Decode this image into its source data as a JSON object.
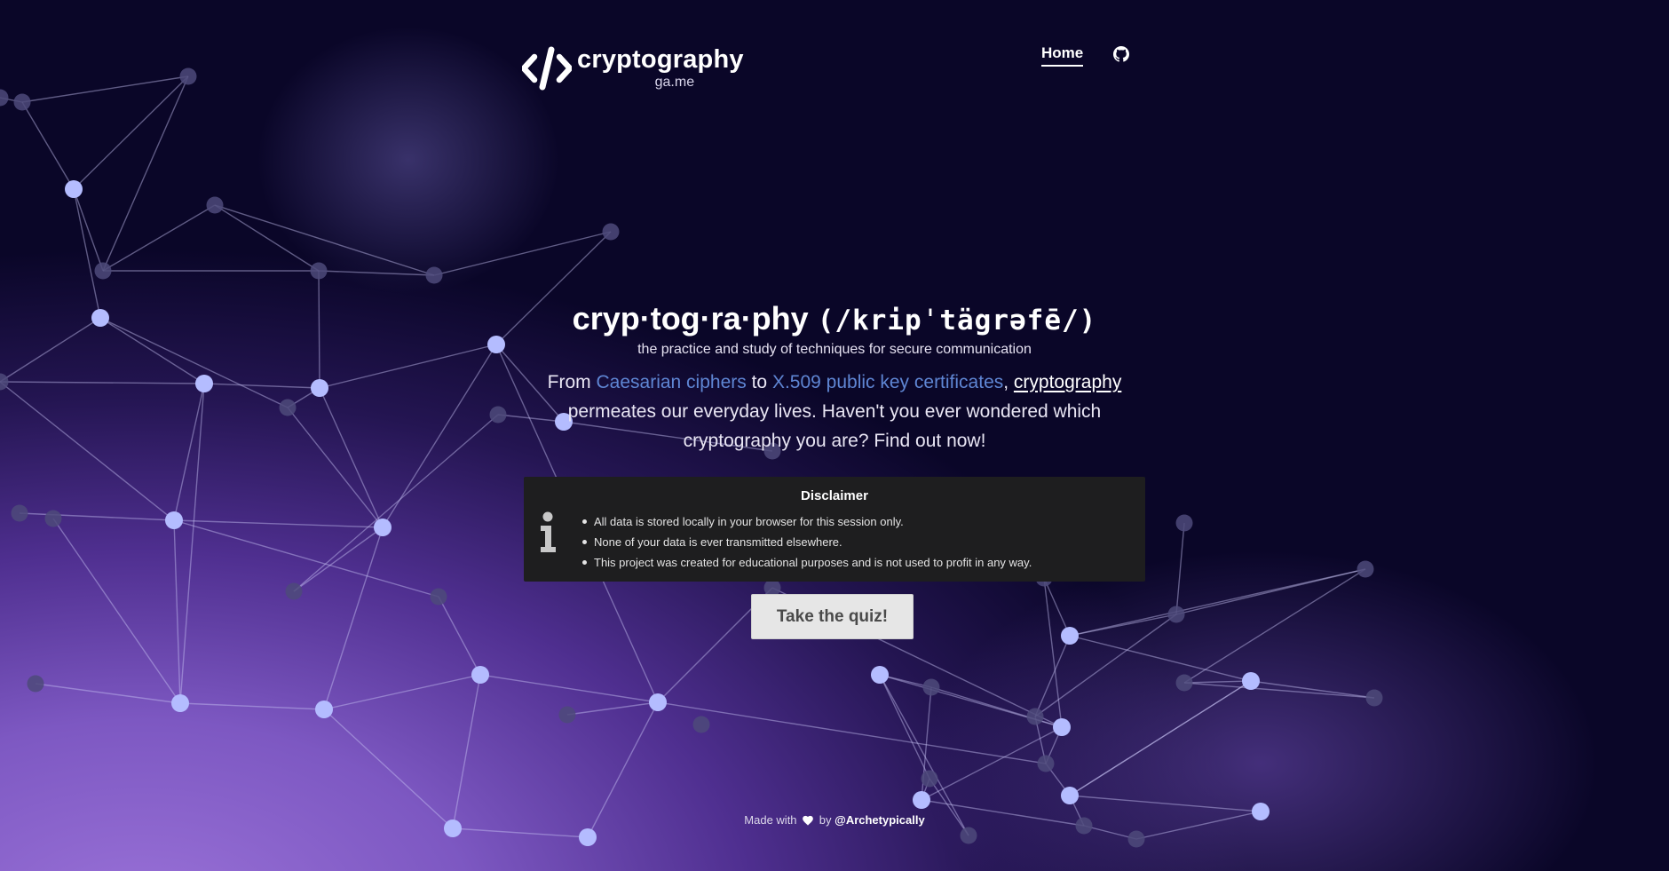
{
  "brand": {
    "name": "cryptography",
    "domain": "ga.me"
  },
  "nav": {
    "home_label": "Home",
    "github_icon": "github-icon"
  },
  "hero": {
    "title_word": "cryp·tog·ra·phy",
    "title_pronunciation": "(/kripˈtägrəfē/)",
    "subtitle": "the practice and study of techniques for secure communication",
    "body": {
      "part1": "From ",
      "link1": "Caesarian ciphers",
      "part2": " to ",
      "link2": "X.509 public key certificates",
      "part3": ", ",
      "link3": "cryptography",
      "part4": " permeates our everyday lives. Haven't you ever wondered which cryptography you are? Find out now!"
    }
  },
  "disclaimer": {
    "icon": "info-icon",
    "title": "Disclaimer",
    "items": [
      "All data is stored locally in your browser for this session only.",
      "None of your data is ever transmitted elsewhere.",
      "This project was created for educational purposes and is not used to profit in any way."
    ]
  },
  "cta": {
    "label": "Take the quiz!"
  },
  "footer": {
    "made_with": "Made with",
    "heart_icon": "heart-icon",
    "by": "by",
    "handle": "@Archetypically"
  },
  "colors": {
    "background_dark": "#0a0628",
    "background_purple": "#9a72d8",
    "link_blue": "#5f86d4",
    "disclaimer_bg": "#1e1e1f",
    "button_bg": "#e6e6e6",
    "node_bright": "#b4bcff",
    "node_dim": "#4d4a7a"
  }
}
